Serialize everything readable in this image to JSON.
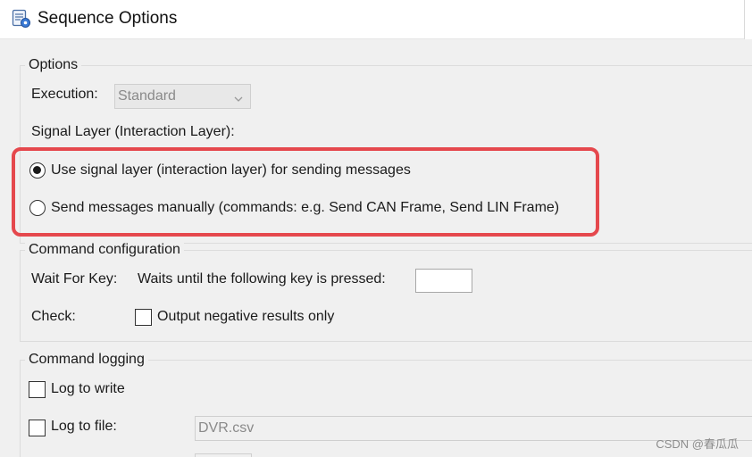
{
  "window": {
    "title": "Sequence Options",
    "icon": "sequence-settings-icon"
  },
  "options": {
    "legend": "Options",
    "execution_label": "Execution:",
    "execution_value": "Standard",
    "signal_layer_label": "Signal Layer (Interaction Layer):",
    "radios": [
      {
        "label": "Use signal layer (interaction layer) for sending messages",
        "selected": true
      },
      {
        "label": "Send messages manually (commands: e.g. Send CAN Frame, Send LIN Frame)",
        "selected": false
      }
    ]
  },
  "command_configuration": {
    "legend": "Command configuration",
    "wait_for_key_label": "Wait For Key:",
    "wait_for_key_desc": "Waits until the following key is pressed:",
    "wait_for_key_value": "",
    "check_label": "Check:",
    "output_negative_label": "Output negative results only",
    "output_negative_checked": false
  },
  "command_logging": {
    "legend": "Command logging",
    "log_to_write_label": "Log to write",
    "log_to_write_checked": false,
    "log_to_file_label": "Log to file:",
    "log_to_file_checked": false,
    "log_file_value": "DVR.csv"
  },
  "watermark": "CSDN @春瓜瓜",
  "colors": {
    "highlight": "#e5484d",
    "window_bg": "#f0f0f0",
    "titlebar_bg": "#ffffff"
  }
}
